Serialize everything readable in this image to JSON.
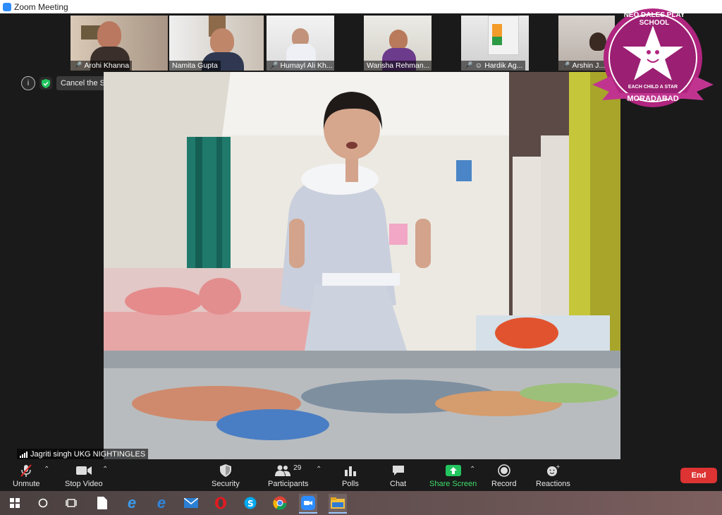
{
  "window": {
    "title": "Zoom Meeting"
  },
  "participants_strip": [
    {
      "name": "Arohi Khanna",
      "muted": true
    },
    {
      "name": "Namita Gupta",
      "muted": false
    },
    {
      "name": "Humayl Ali Kh...",
      "muted": true
    },
    {
      "name": "Warisha Rehman...",
      "muted": false
    },
    {
      "name": "Hardik Ag...",
      "muted": true
    },
    {
      "name": "Arshin J...",
      "muted": true
    }
  ],
  "spotlight": {
    "cancel_label": "Cancel the Spotlight Video"
  },
  "active_speaker": {
    "label": "Jagriti singh UKG NIGHTINGLES"
  },
  "logo": {
    "top_text": "NEO DALES PLAY SCHOOL",
    "ribbon_text": "EACH CHILD A STAR",
    "bottom_text": "MORADABAD"
  },
  "toolbar": {
    "unmute": "Unmute",
    "stop_video": "Stop Video",
    "security": "Security",
    "participants": "Participants",
    "participants_count": "29",
    "polls": "Polls",
    "chat": "Chat",
    "share_screen": "Share Screen",
    "record": "Record",
    "reactions": "Reactions",
    "end": "End"
  },
  "colors": {
    "accent": "#2d8cff",
    "share": "#22c55e",
    "end": "#dd3333",
    "logo": "#b0257f"
  },
  "taskbar": [
    "windows-start-icon",
    "cortana-icon",
    "task-view-icon",
    "file-icon",
    "edge-icon",
    "ie-icon",
    "mail-icon",
    "opera-icon",
    "skype-icon",
    "chrome-icon",
    "zoom-icon",
    "file-explorer-icon"
  ]
}
